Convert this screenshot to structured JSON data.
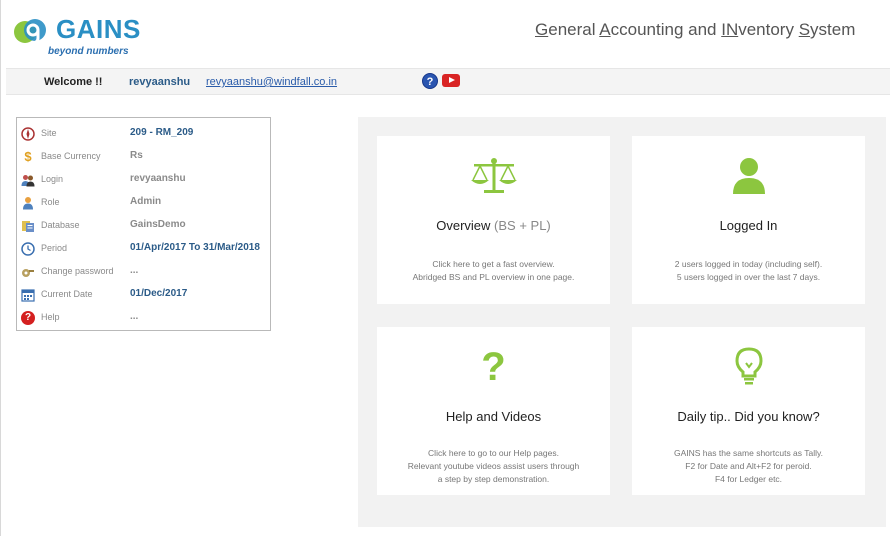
{
  "header": {
    "logo_text": "GAINS",
    "logo_tagline": "beyond numbers",
    "system_title_parts": [
      "G",
      "eneral ",
      "A",
      "ccounting and ",
      "IN",
      "ventory ",
      "S",
      "ystem"
    ]
  },
  "welcome": {
    "label": "Welcome !!",
    "username": "revyaanshu",
    "email": "revyaanshu@windfall.co.in"
  },
  "info": [
    {
      "label": "Site",
      "value": "209 - RM_209",
      "icon": "compass-icon",
      "blue": true
    },
    {
      "label": "Base Currency",
      "value": "Rs",
      "icon": "dollar-icon",
      "blue": false
    },
    {
      "label": "Login",
      "value": "revyaanshu",
      "icon": "users-icon",
      "blue": false
    },
    {
      "label": "Role",
      "value": "Admin",
      "icon": "person-icon",
      "blue": false
    },
    {
      "label": "Database",
      "value": "GainsDemo",
      "icon": "database-icon",
      "blue": false
    },
    {
      "label": "Period",
      "value": "01/Apr/2017 To 31/Mar/2018",
      "icon": "clock-icon",
      "blue": true
    },
    {
      "label": "Change password",
      "value": "...",
      "icon": "key-icon",
      "blue": false
    },
    {
      "label": "Current Date",
      "value": "01/Dec/2017",
      "icon": "calendar-icon",
      "blue": true
    },
    {
      "label": "Help",
      "value": "...",
      "icon": "help-icon",
      "blue": false
    }
  ],
  "cards": {
    "overview": {
      "title_main": "Overview ",
      "title_muted": "(BS + PL)",
      "desc": [
        "Click here to get a fast overview.",
        "Abridged BS and PL overview in one page."
      ]
    },
    "logged_in": {
      "title": "Logged In",
      "desc": [
        "2 users logged in today (including self).",
        "5 users logged in over the last 7 days."
      ]
    },
    "help": {
      "title": "Help and Videos",
      "desc": [
        "Click here to go to our Help pages.",
        "Relevant youtube videos assist users through",
        "a step by step demonstration."
      ]
    },
    "tip": {
      "title": "Daily tip.. Did you know?",
      "desc": [
        "GAINS has the same shortcuts as Tally.",
        "F2 for Date and Alt+F2 for peroid.",
        "F4 for Ledger etc."
      ]
    }
  },
  "colors": {
    "accent_green": "#8cc63f",
    "brand_blue": "#2a8fc4"
  }
}
